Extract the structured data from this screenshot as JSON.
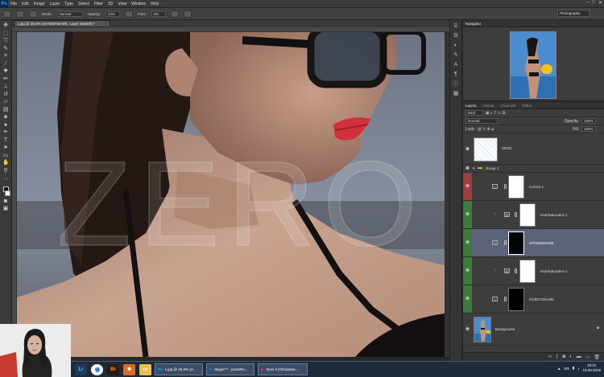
{
  "app": {
    "logo": "Ps"
  },
  "menu": [
    "File",
    "Edit",
    "Image",
    "Layer",
    "Type",
    "Select",
    "Filter",
    "3D",
    "View",
    "Window",
    "Help"
  ],
  "window_controls": [
    "–",
    "□",
    "✕"
  ],
  "options": {
    "mode_label": "Mode:",
    "mode_value": "Normal",
    "opacity_label": "Opacity:",
    "opacity_value": "22%",
    "flow_label": "Flow:",
    "flow_value": "4%",
    "workspace": "Photography"
  },
  "document": {
    "tab_title": "1.jpg @ 36,5% (ЗАТЕМНЕНИЕ, Layer Mask/8) *",
    "watermark": "ZERO"
  },
  "navigator": {
    "tabs": [
      "Navigator"
    ]
  },
  "layers_panel": {
    "tabs": [
      "Layers",
      "History",
      "Channels",
      "Paths"
    ],
    "kind_label": "Kind",
    "blend_mode": "Normal",
    "opacity_label": "Opacity:",
    "opacity_value": "100%",
    "lock_label": "Lock:",
    "fill_label": "Fill:",
    "fill_value": "100%",
    "layers": [
      {
        "name": "ZERO",
        "kind": "pattern",
        "tag": "none"
      },
      {
        "name": "Group 1",
        "kind": "group",
        "tag": "none"
      },
      {
        "name": "Curves 1",
        "kind": "adjustment",
        "tag": "red"
      },
      {
        "name": "Hue/Saturation 1",
        "kind": "adjustment",
        "tag": "green"
      },
      {
        "name": "ЗАТЕМНЕНИЕ",
        "kind": "mask",
        "tag": "green"
      },
      {
        "name": "Hue/Saturation 1",
        "kind": "adjustment",
        "tag": "green"
      },
      {
        "name": "ОСВЕТЛЕНИЕ",
        "kind": "mask",
        "tag": "green"
      },
      {
        "name": "Background",
        "kind": "photo",
        "tag": "none"
      }
    ]
  },
  "taskbar": {
    "windows": [
      "1.jpg @ 36,5% (З...",
      "Skype™ - pua18%...",
      "Урок 3 [Обтравка..."
    ],
    "lang": "EN",
    "time": "20:31",
    "date": "10.09.2015"
  },
  "colors": {
    "tag_red": "#a23b3b",
    "tag_green": "#3e7a3e",
    "selected_row": "#5b6378",
    "lips": "#d2303a"
  },
  "icons": [
    "photoshop-logo",
    "move-tool-icon",
    "marquee-tool-icon",
    "lasso-tool-icon",
    "brush-tool-icon",
    "eye-icon",
    "chain-link-icon",
    "start-icon"
  ]
}
